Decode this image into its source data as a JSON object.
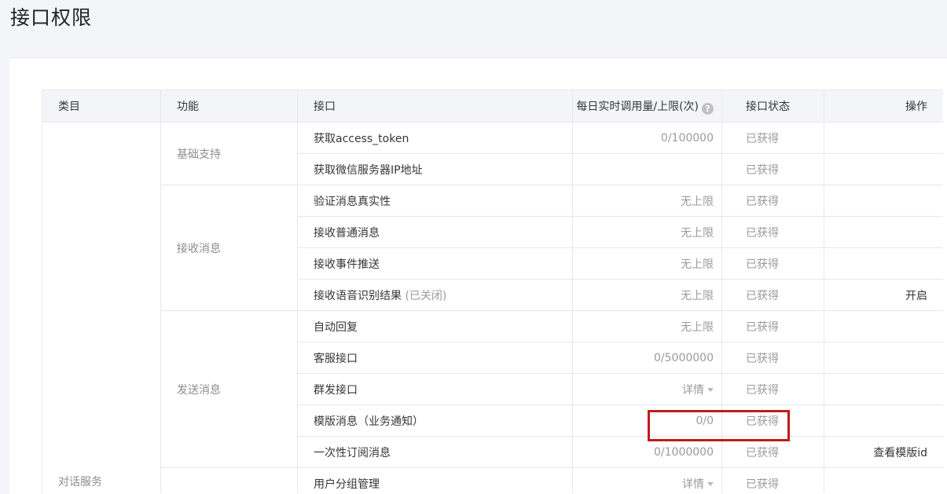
{
  "page": {
    "title": "接口权限"
  },
  "table": {
    "headers": {
      "category": "类目",
      "function": "功能",
      "api": "接口",
      "quota": "每日实时调用量/上限(次)",
      "status": "接口状态",
      "operation": "操作"
    },
    "help_icon_glyph": "?",
    "category": "对话服务",
    "groups": {
      "basic": "基础支持",
      "receive": "接收消息",
      "send": "发送消息"
    },
    "rows": [
      {
        "api": "获取access_token",
        "quota": "0/100000",
        "status": "已获得",
        "op": ""
      },
      {
        "api": "获取微信服务器IP地址",
        "quota": "",
        "status": "已获得",
        "op": ""
      },
      {
        "api": "验证消息真实性",
        "quota": "无上限",
        "status": "已获得",
        "op": ""
      },
      {
        "api": "接收普通消息",
        "quota": "无上限",
        "status": "已获得",
        "op": ""
      },
      {
        "api": "接收事件推送",
        "quota": "无上限",
        "status": "已获得",
        "op": ""
      },
      {
        "api": "接收语音识别结果",
        "api_note": "(已关闭)",
        "quota": "无上限",
        "status": "已获得",
        "op": "开启"
      },
      {
        "api": "自动回复",
        "quota": "无上限",
        "status": "已获得",
        "op": ""
      },
      {
        "api": "客服接口",
        "quota": "0/5000000",
        "status": "已获得",
        "op": ""
      },
      {
        "api": "群发接口",
        "quota": "详情",
        "status": "已获得",
        "op": ""
      },
      {
        "api": "模版消息（业务通知）",
        "quota": "0/0",
        "status": "已获得",
        "op": ""
      },
      {
        "api": "一次性订阅消息",
        "quota": "0/1000000",
        "status": "已获得",
        "op": "查看模版id"
      },
      {
        "api": "用户分组管理",
        "quota": "详情",
        "status": "已获得",
        "op": ""
      }
    ]
  },
  "colors": {
    "highlight_border": "#c21a1a",
    "header_bg": "#f4f5f9"
  }
}
